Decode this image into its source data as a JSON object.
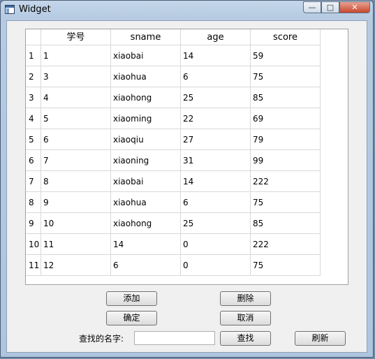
{
  "window": {
    "title": "Widget"
  },
  "table": {
    "headers": [
      "学号",
      "sname",
      "age",
      "score"
    ],
    "rows": [
      {
        "num": "1",
        "cells": [
          "1",
          "xiaobai",
          "14",
          "59"
        ]
      },
      {
        "num": "2",
        "cells": [
          "3",
          "xiaohua",
          "6",
          "75"
        ]
      },
      {
        "num": "3",
        "cells": [
          "4",
          "xiaohong",
          "25",
          "85"
        ]
      },
      {
        "num": "4",
        "cells": [
          "5",
          "xiaoming",
          "22",
          "69"
        ]
      },
      {
        "num": "5",
        "cells": [
          "6",
          "xiaoqiu",
          "27",
          "79"
        ]
      },
      {
        "num": "6",
        "cells": [
          "7",
          "xiaoning",
          "31",
          "99"
        ]
      },
      {
        "num": "7",
        "cells": [
          "8",
          "xiaobai",
          "14",
          "222"
        ]
      },
      {
        "num": "8",
        "cells": [
          "9",
          "xiaohua",
          "6",
          "75"
        ]
      },
      {
        "num": "9",
        "cells": [
          "10",
          "xiaohong",
          "25",
          "85"
        ]
      },
      {
        "num": "10",
        "cells": [
          "11",
          "14",
          "0",
          "222"
        ]
      },
      {
        "num": "11",
        "cells": [
          "12",
          "6",
          "0",
          "75"
        ]
      }
    ]
  },
  "buttons": {
    "add": "添加",
    "delete": "删除",
    "confirm": "确定",
    "cancel": "取消",
    "search": "查找",
    "refresh": "刷新"
  },
  "search": {
    "label": "查找的名字:",
    "value": ""
  }
}
